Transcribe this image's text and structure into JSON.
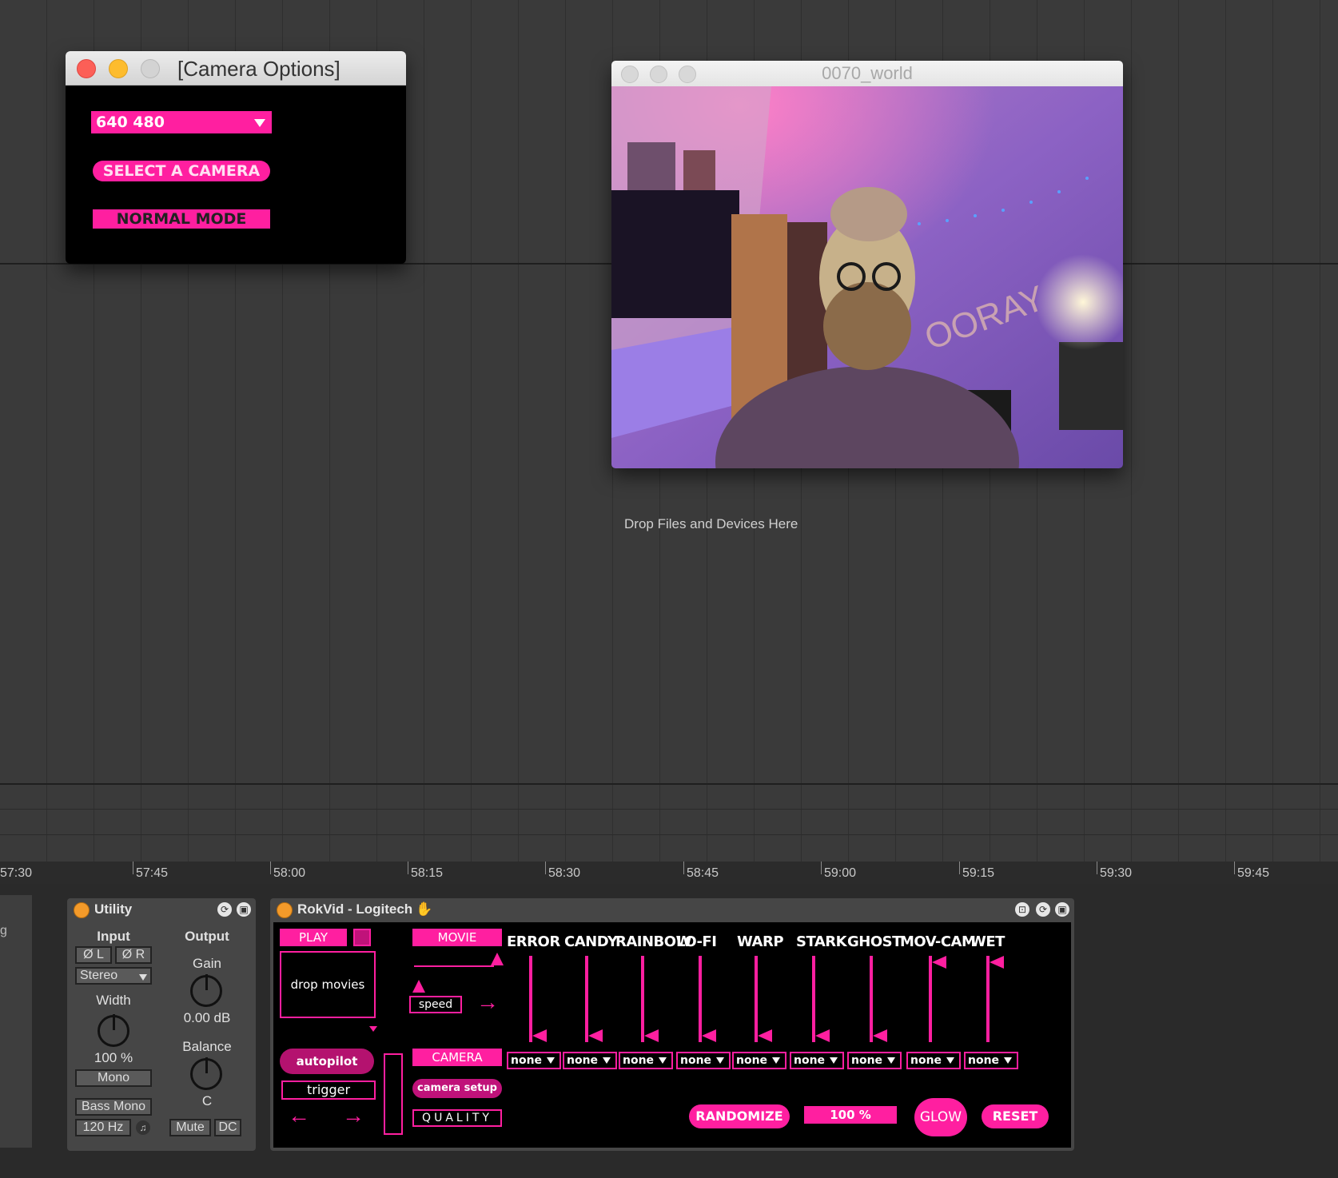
{
  "camera_options": {
    "title": "[Camera Options]",
    "resolution": "640 480",
    "select_camera": "SELECT A CAMERA",
    "normal_mode": "NORMAL MODE"
  },
  "world_window": {
    "title": "0070_world"
  },
  "arrangement": {
    "drop_hint": "Drop Files and Devices Here"
  },
  "timeline": {
    "ticks": [
      "57:30",
      "57:45",
      "58:00",
      "58:15",
      "58:30",
      "58:45",
      "59:00",
      "59:15",
      "59:30",
      "59:45"
    ]
  },
  "left_stub": {
    "text": "g"
  },
  "utility": {
    "title": "Utility",
    "input_label": "Input",
    "output_label": "Output",
    "phase_left": "Ø L",
    "phase_right": "Ø R",
    "channel_mode": "Stereo",
    "width_label": "Width",
    "width_value": "100 %",
    "mono": "Mono",
    "bass_mono": "Bass Mono",
    "bass_freq": "120 Hz",
    "gain_label": "Gain",
    "gain_value": "0.00 dB",
    "balance_label": "Balance",
    "balance_value": "C",
    "mute": "Mute",
    "dc": "DC"
  },
  "rokvid": {
    "title": "RokVid - Logitech",
    "play": "PLAY",
    "drop_movies": "drop movies",
    "movie": "MOVIE",
    "speed": "speed",
    "autopilot": "autopilot",
    "trigger": "trigger",
    "camera": "CAMERA",
    "camera_setup": "camera setup",
    "quality": "QUALITY",
    "randomize": "RANDOMIZE",
    "mix_value": "100 %",
    "glow": "GLOW",
    "reset": "RESET",
    "effects": [
      {
        "label": "ERROR",
        "mod": "none",
        "level": 0
      },
      {
        "label": "CANDY",
        "mod": "none",
        "level": 0
      },
      {
        "label": "RAINBOW",
        "mod": "none",
        "level": 0
      },
      {
        "label": "LO-FI",
        "mod": "none",
        "level": 0
      },
      {
        "label": "WARP",
        "mod": "none",
        "level": 0
      },
      {
        "label": "STARK",
        "mod": "none",
        "level": 0
      },
      {
        "label": "GHOST",
        "mod": "none",
        "level": 0
      },
      {
        "label": "MOV-CAM",
        "mod": "none",
        "level": 1
      },
      {
        "label": "WET",
        "mod": "none",
        "level": 1
      }
    ]
  },
  "colors": {
    "accent": "#ff1fa0",
    "device_on": "#f39a2a"
  }
}
